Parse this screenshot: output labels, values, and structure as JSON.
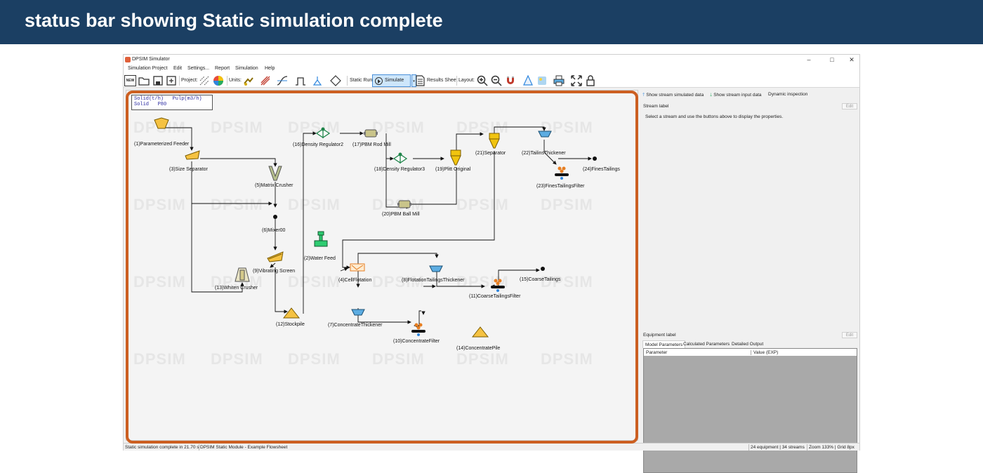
{
  "banner": {
    "title": "status bar showing Static simulation complete"
  },
  "window": {
    "title": "DPSIM Simulator",
    "controls": {
      "minimize": "–",
      "maximize": "□",
      "close": "✕"
    }
  },
  "menu": [
    "Simulation Project",
    "Edit",
    "Settings...",
    "Report",
    "Simulation",
    "Help"
  ],
  "toolbar": {
    "new_label": "NEW",
    "project_label": "Project:",
    "units_label": "Units:",
    "static_run_label": "Static Run",
    "simulate_label": "Simulate",
    "results_sheet_label": "Results Sheet",
    "layout_label": "Layout:"
  },
  "canvas": {
    "legend_line1": "Solid(t/h)   Pulp(m3/h)",
    "legend_line2": "Solid   P80",
    "watermark": "DPSIM",
    "nodes": {
      "n1": "(1)Parameterized Feeder",
      "n2": "(2)Water Feed",
      "n3": "(3)Size Separator",
      "n4": "(4)CellFlotation",
      "n5": "(5)Matrix Crusher",
      "n6": "(6)Mixer00",
      "n7": "(7)ConcentrateThickener",
      "n8": "(8)FlotationTailingsThickener",
      "n9": "(9)Vibrating Screen",
      "n10": "(10)ConcentrateFilter",
      "n11": "(11)CoarseTailingsFilter",
      "n12": "(12)Stockpile",
      "n13": "(13)Whiten Crusher",
      "n14": "(14)ConcentratePile",
      "n15": "(15)CoarseTailings",
      "n16": "(16)Density Regulator2",
      "n17": "(17)PBM Rod Mill",
      "n18": "(18)Density Regulator3",
      "n19": "(19)Plitt Original",
      "n20": "(20)PBM Ball Mill",
      "n21": "(21)Separator",
      "n22": "(22)TailinsThickener",
      "n23": "(23)FinesTailingsFilter",
      "n24": "(24)FinesTailings"
    }
  },
  "right_panel": {
    "show_simulated": "Show stream simulated data",
    "show_input": "Show stream input data",
    "dynamic_inspection": "Dynamic inspection",
    "stream_label": "Stream label",
    "edit_label": "Edit",
    "hint": "Select a stream and use the buttons above to display the properties.",
    "equipment_label": "Equipment label",
    "tabs": [
      "Model Parameters",
      "Calculated Parameters",
      "Detailed Output"
    ],
    "table_headers": [
      "Parameter",
      "Value (EXP)"
    ]
  },
  "status": {
    "message": "Static simulation complete in 21.70 s",
    "module": "DPSIM Static Module - Example Flowsheet",
    "counts": "24 equipment | 34 streams",
    "zoom": "Zoom 133% | Grid 8px"
  },
  "colors": {
    "banner": "#1b3f63",
    "highlight": "#cc5f21",
    "simulate_active": "#cde6fb"
  }
}
